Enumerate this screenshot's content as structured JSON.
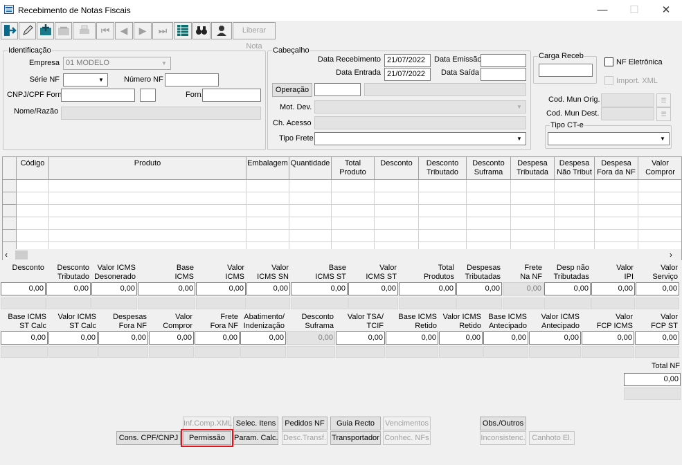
{
  "window": {
    "title": "Recebimento de Notas Fiscais",
    "minimize": "—",
    "maximize": "☐",
    "close": "✕"
  },
  "toolbar": {
    "exit_icon": "exit-door-icon",
    "edit_icon": "pencil-icon",
    "add_icon": "add-folder-icon",
    "liberar": "Liberar Nota"
  },
  "identificacao": {
    "legend": "Identificação",
    "empresa_label": "Empresa",
    "empresa_value": "01 MODELO",
    "serie_label": "Série NF",
    "serie_value": "",
    "numero_label": "Número NF",
    "numero_value": "",
    "cnpj_label": "CNPJ/CPF Forn.",
    "cnpj_value": "",
    "forn_label": "Forn.",
    "forn_value": "",
    "nome_label": "Nome/Razão",
    "nome_value": ""
  },
  "cabecalho": {
    "legend": "Cabeçalho",
    "data_receb_label": "Data Recebimento",
    "data_receb_value": "21/07/2022",
    "data_emissao_label": "Data Emissão",
    "data_emissao_value": "",
    "data_entrada_label": "Data Entrada",
    "data_entrada_value": "21/07/2022",
    "data_saida_label": "Data Saída",
    "data_saida_value": "",
    "operacao_btn": "Operação",
    "operacao_value": "",
    "mot_dev_label": "Mot. Dev.",
    "ch_acesso_label": "Ch. Acesso",
    "tipo_frete_label": "Tipo Frete"
  },
  "carga": {
    "legend": "Carga Receb",
    "value": ""
  },
  "nf_eletronica": "NF Eletrônica",
  "import_xml": "Import. XML",
  "cod_mun_orig": "Cod. Mun Orig.",
  "cod_mun_dest": "Cod. Mun Dest.",
  "tipo_cte": {
    "legend": "Tipo CT-e"
  },
  "grid": {
    "columns": [
      "Código",
      "Produto",
      "Embalagem",
      "Quantidade",
      "Total\nProduto",
      "Desconto",
      "Desconto\nTributado",
      "Desconto\nSuframa",
      "Despesa\nTributada",
      "Despesa\nNão Tribut",
      "Despesa\nFora da NF",
      "Valor\nCompror"
    ]
  },
  "totals1": {
    "labels": [
      "Desconto",
      "Desconto\nTributado",
      "Valor ICMS\nDesonerado",
      "Base\nICMS",
      "Valor\nICMS",
      "Valor\nICMS SN",
      "Base\nICMS ST",
      "Valor\nICMS ST",
      "Total\nProdutos",
      "Despesas\nTributadas",
      "Frete\nNa NF",
      "Desp não\nTributadas",
      "Valor\nIPI",
      "Valor\nServiço"
    ],
    "values": [
      "0,00",
      "0,00",
      "0,00",
      "0,00",
      "0,00",
      "0,00",
      "0,00",
      "0,00",
      "0,00",
      "0,00",
      "0,00",
      "0,00",
      "0,00",
      "0,00"
    ]
  },
  "totals2": {
    "labels": [
      "Base ICMS\nST Calc",
      "Valor ICMS\nST Calc",
      "Despesas\nFora NF",
      "Valor\nCompror",
      "Frete\nFora NF",
      "Abatimento/\nIndenização",
      "Desconto\nSuframa",
      "Valor TSA/\nTCIF",
      "Base ICMS\nRetido",
      "Valor ICMS\nRetido",
      "Base ICMS\nAntecipado",
      "Valor ICMS\nAntecipado",
      "Valor\nFCP ICMS",
      "Valor\nFCP ST"
    ],
    "values": [
      "0,00",
      "0,00",
      "0,00",
      "0,00",
      "0,00",
      "0,00",
      "0,00",
      "0,00",
      "0,00",
      "0,00",
      "0,00",
      "0,00",
      "0,00",
      "0,00"
    ]
  },
  "total_nf": {
    "label": "Total NF",
    "value": "0,00"
  },
  "buttons": {
    "inf_comp_xml": "Inf.Comp.XML",
    "selec_itens": "Selec. Itens",
    "pedidos_nf": "Pedidos NF",
    "guia_recto": "Guia Recto",
    "vencimentos": "Vencimentos",
    "obs_outros": "Obs./Outros",
    "cons_cpf": "Cons. CPF/CNPJ",
    "permissao": "Permissão",
    "param_calc": "Param. Calc.",
    "desc_transf": "Desc.Transf.",
    "transportador": "Transportador",
    "conhec_nfs": "Conhec. NFs",
    "inconsistenc": "Inconsistenc.",
    "canhoto": "Canhoto El."
  },
  "colors": {
    "highlight": "#e0141e",
    "toolbar_teal": "#0a6f6f"
  }
}
